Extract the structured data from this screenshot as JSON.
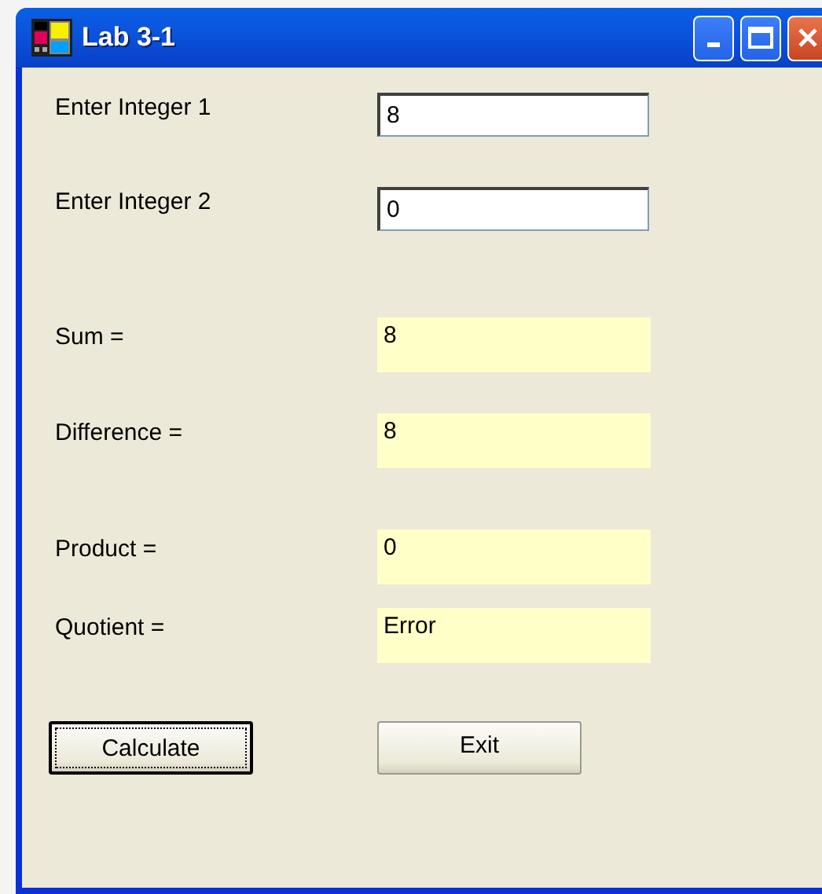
{
  "window": {
    "title": "Lab 3-1"
  },
  "inputs": [
    {
      "label": "Enter Integer 1",
      "value": "8"
    },
    {
      "label": "Enter Integer 2",
      "value": "0"
    }
  ],
  "outputs": [
    {
      "label": "Sum =",
      "value": "8"
    },
    {
      "label": "Difference =",
      "value": "8"
    },
    {
      "label": "Product =",
      "value": "0"
    },
    {
      "label": "Quotient =",
      "value": "Error"
    }
  ],
  "buttons": [
    {
      "label": "Calculate",
      "focused": true
    },
    {
      "label": "Exit",
      "focused": false
    }
  ]
}
